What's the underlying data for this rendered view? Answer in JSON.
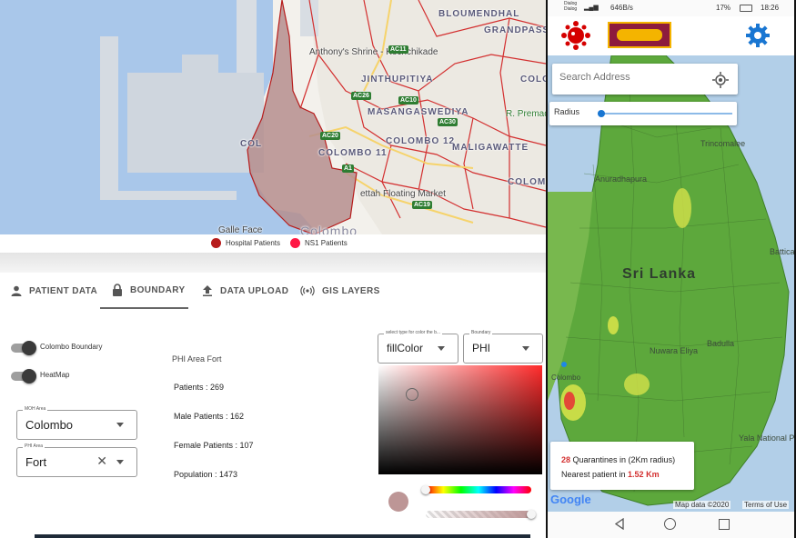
{
  "left_map": {
    "area_labels": [
      "BLOUMENDHAL",
      "GRANDPASS",
      "JINTHUPITIYA",
      "MASANGASWEDIYA",
      "COLOMBO 12",
      "COLOMBO 11",
      "MALIGAWATTE",
      "COLOMBO",
      "COLOMBO",
      "COL",
      "Colombo"
    ],
    "pois": [
      "Anthony's Shrine - Kochchikade",
      "R. Premad International S",
      "ettah Floating Market",
      "Galle Face"
    ],
    "road_shields": [
      "AC11",
      "AC26",
      "AC10",
      "AC20",
      "AC30",
      "A1",
      "AC19"
    ],
    "legend": [
      {
        "label": "Hospital Patients",
        "color": "#b71c1c"
      },
      {
        "label": "NS1 Patients",
        "color": "#ff1744"
      }
    ]
  },
  "tabs": [
    {
      "label": "PATIENT DATA",
      "icon": "person-icon"
    },
    {
      "label": "BOUNDARY",
      "icon": "lock-icon",
      "active": true
    },
    {
      "label": "DATA UPLOAD",
      "icon": "upload-icon"
    },
    {
      "label": "GIS LAYERS",
      "icon": "broadcast-icon"
    }
  ],
  "boundary_panel": {
    "toggles": [
      {
        "label": "Colombo Boundary",
        "on": true
      },
      {
        "label": "HeatMap",
        "on": true
      }
    ],
    "moh_area": {
      "label": "MOH Area",
      "value": "Colombo"
    },
    "phi_area": {
      "label": "PHI Area",
      "value": "Fort"
    },
    "phi_title": "PHI Area Fort",
    "stats": [
      "Patients : 269",
      "Male Patients : 162",
      "Female Patients : 107",
      "Population : 1473"
    ],
    "color_type": {
      "label": "select type for color the b...",
      "value": "fillColor"
    },
    "boundary_type": {
      "label": "Boundary",
      "value": "PHI"
    },
    "selected_color": "#bd9696"
  },
  "phone": {
    "status": {
      "carrier_line1": "Dialog",
      "carrier_line2": "Dialog",
      "speed": "646B/s",
      "battery": "17%",
      "time": "18:26"
    },
    "search_placeholder": "Search Address",
    "radius_label": "Radius",
    "radius_level": 0.02,
    "map_labels": [
      "Trincomalee",
      "Anuradhapura",
      "Sri Lanka",
      "Batticaloa",
      "Nuwara Eliya",
      "Badulla",
      "Yala National Park",
      "Colombo"
    ],
    "info": {
      "quarantine_count": "28",
      "quarantine_text": " Quarantines in (2Km radius)",
      "nearest_text": "Nearest patient in ",
      "nearest_distance": "1.52 Km"
    },
    "google_logo": "Google",
    "map_data": "Map data ©2020",
    "terms": "Terms of Use"
  }
}
